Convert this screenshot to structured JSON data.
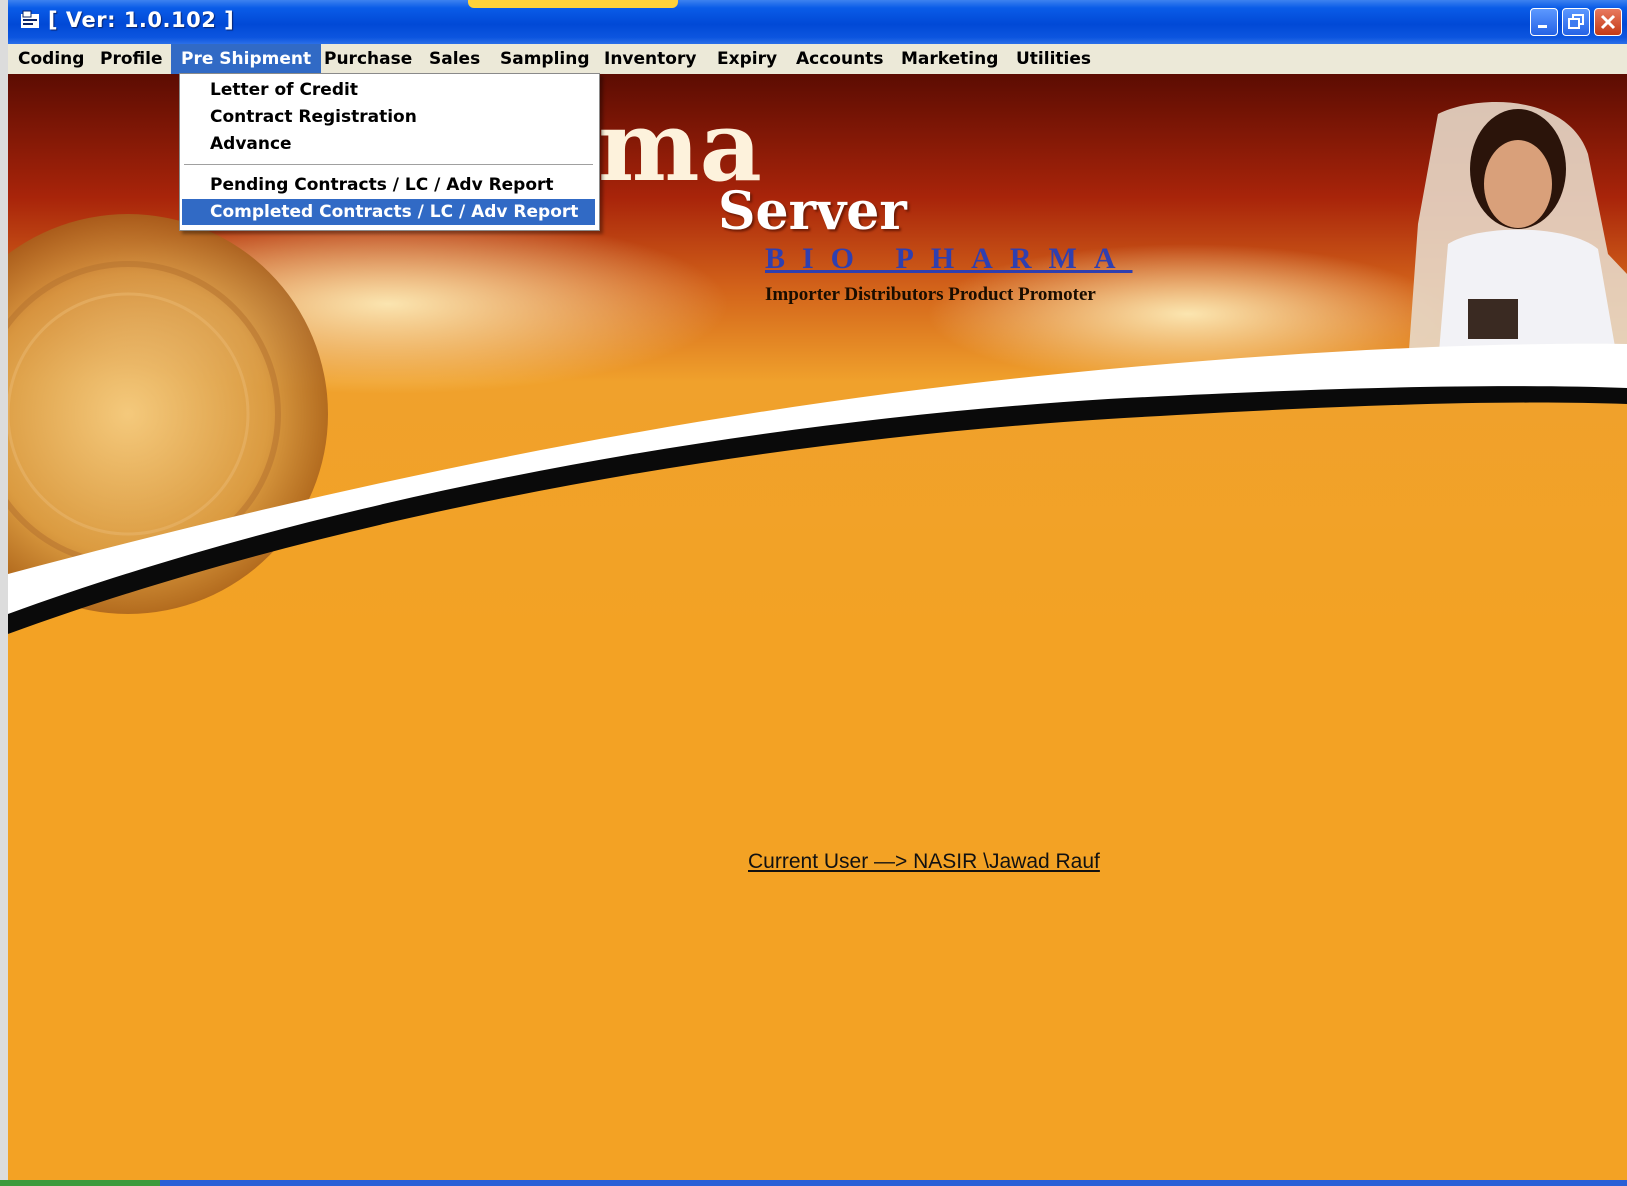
{
  "window": {
    "title": "[ Ver: 1.0.102 ]"
  },
  "menubar": {
    "items": [
      {
        "label": "Coding"
      },
      {
        "label": "Profile"
      },
      {
        "label": "Pre Shipment"
      },
      {
        "label": "Purchase"
      },
      {
        "label": "Sales"
      },
      {
        "label": "Sampling"
      },
      {
        "label": "Inventory"
      },
      {
        "label": "Expiry"
      },
      {
        "label": "Accounts"
      },
      {
        "label": "Marketing"
      },
      {
        "label": "Utilities"
      }
    ],
    "active": "Pre Shipment"
  },
  "dropdown": {
    "items": [
      {
        "label": "Letter of Credit"
      },
      {
        "label": "Contract Registration"
      },
      {
        "label": "Advance"
      },
      {
        "label": "Pending Contracts / LC / Adv Report"
      },
      {
        "label": "Completed Contracts / LC / Adv Report"
      }
    ],
    "selected": "Completed Contracts / LC / Adv Report"
  },
  "banner": {
    "logo_partial": "ma",
    "logo_server": "Server",
    "company": "BIO PHARMA",
    "tagline": "Importer Distributors Product Promoter"
  },
  "status": {
    "current_user": "Current User —> NASIR \\Jawad Rauf"
  },
  "colors": {
    "titlebar": "#0149d6",
    "menubar": "#ece9d8",
    "selection": "#316ac5",
    "background_orange": "#f3a224",
    "banner_red": "#9c1e08"
  }
}
